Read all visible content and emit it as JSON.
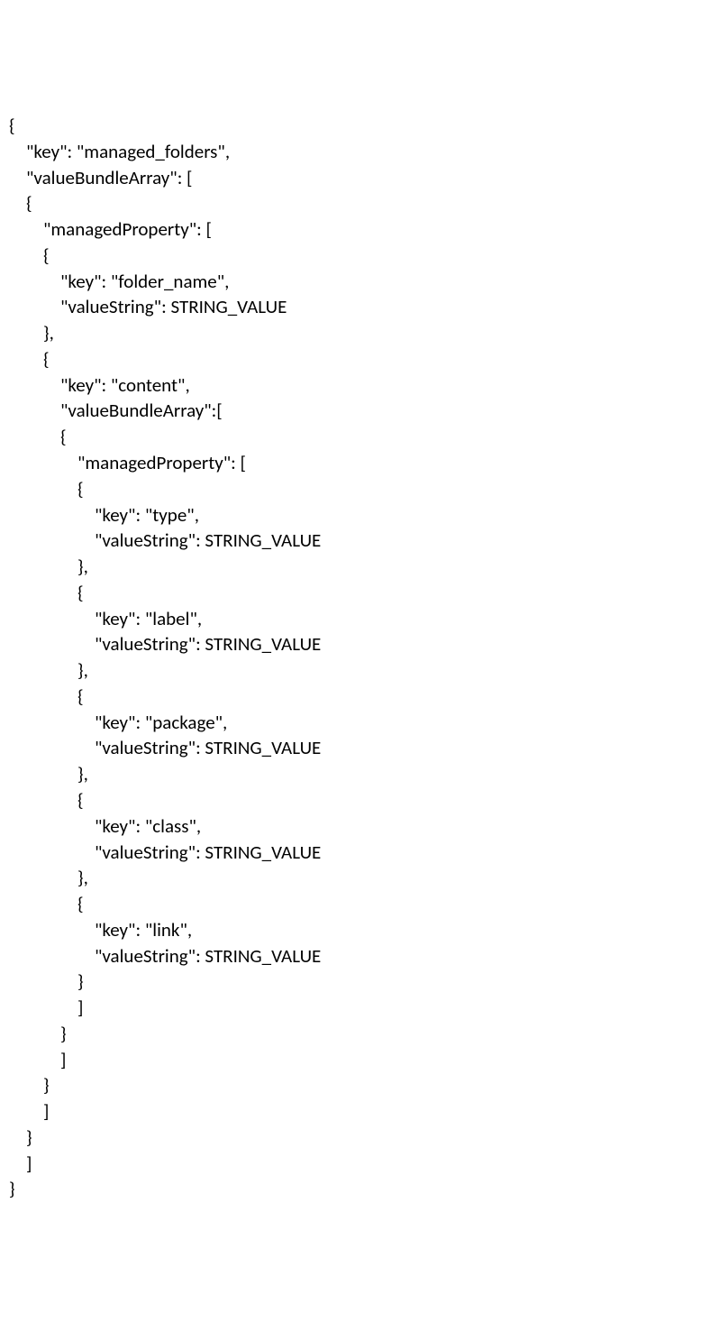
{
  "code": {
    "l01": "{",
    "l02": "    \"key\": \"managed_folders\",",
    "l03": "    \"valueBundleArray\": [",
    "l04": "    {",
    "l05": "        \"managedProperty\": [",
    "l06": "        {",
    "l07": "            \"key\": \"folder_name\",",
    "l08": "            \"valueString\": STRING_VALUE",
    "l09": "        },",
    "l10": "        {",
    "l11": "            \"key\": \"content\",",
    "l12": "            \"valueBundleArray\":[",
    "l13": "            {",
    "l14": "                \"managedProperty\": [",
    "l15": "                {",
    "l16": "                    \"key\": \"type\",",
    "l17": "                    \"valueString\": STRING_VALUE",
    "l18": "                },",
    "l19": "                {",
    "l20": "                    \"key\": \"label\",",
    "l21": "                    \"valueString\": STRING_VALUE",
    "l22": "                },",
    "l23": "                {",
    "l24": "                    \"key\": \"package\",",
    "l25": "                    \"valueString\": STRING_VALUE",
    "l26": "                },",
    "l27": "                {",
    "l28": "                    \"key\": \"class\",",
    "l29": "                    \"valueString\": STRING_VALUE",
    "l30": "                },",
    "l31": "                {",
    "l32": "                    \"key\": \"link\",",
    "l33": "                    \"valueString\": STRING_VALUE",
    "l34": "                }",
    "l35": "                ]",
    "l36": "            }",
    "l37": "            ]",
    "l38": "        }",
    "l39": "        ]",
    "l40": "    }",
    "l41": "    ]",
    "l42": "}"
  }
}
